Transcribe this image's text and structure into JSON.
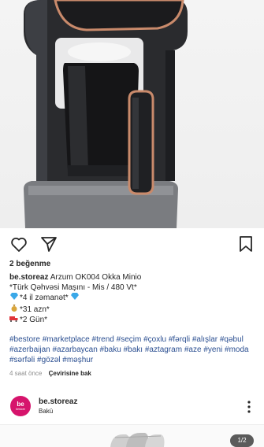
{
  "post": {
    "likes_text": "2 beğenme",
    "username": "be.storeaz",
    "caption_title": "Arzum OK004 Okka Minio",
    "caption_lines": [
      "*Türk Qəhvəsi Maşını - Mis / 480 Vt*",
      "*4 il zəmanət*",
      "*31 azn*",
      "*2 Gün*"
    ],
    "caption_emojis": [
      "diamond-icon",
      "money-bag-icon",
      "delivery-truck-icon"
    ],
    "hashtags": [
      "#bestore",
      "#marketplace",
      "#trend",
      "#seçim",
      "#çoxlu",
      "#fərqli",
      "#alışlar",
      "#qəbul",
      "#azerbaijan",
      "#azarbaycan",
      "#baku",
      "#bakı",
      "#aztagram",
      "#aze",
      "#yeni",
      "#moda",
      "#sərfəli",
      "#gözəl",
      "#məşhur"
    ],
    "time_ago": "4 saat önce",
    "translate_label": "Çevirisine bak"
  },
  "author": {
    "name": "be.storeaz",
    "location": "Bakü",
    "avatar_text_top": "be",
    "avatar_text_bottom": "bestore"
  },
  "carousel": {
    "counter": "1/2"
  },
  "colors": {
    "hashtag": "#2b4f91",
    "avatar_bg": "#d6146c",
    "copper_accent": "#c98a6b"
  }
}
